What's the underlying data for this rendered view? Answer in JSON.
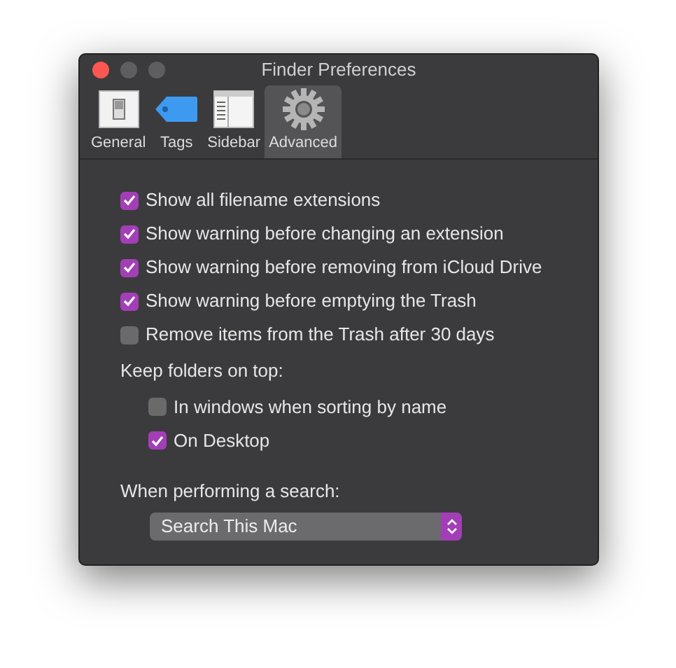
{
  "window": {
    "title": "Finder Preferences"
  },
  "tabs": [
    {
      "label": "General",
      "kind": "general",
      "selected": false
    },
    {
      "label": "Tags",
      "kind": "tags",
      "selected": false
    },
    {
      "label": "Sidebar",
      "kind": "sidebar",
      "selected": false
    },
    {
      "label": "Advanced",
      "kind": "advanced",
      "selected": true
    }
  ],
  "options": [
    {
      "label": "Show all filename extensions",
      "checked": true
    },
    {
      "label": "Show warning before changing an extension",
      "checked": true
    },
    {
      "label": "Show warning before removing from iCloud Drive",
      "checked": true
    },
    {
      "label": "Show warning before emptying the Trash",
      "checked": true
    },
    {
      "label": "Remove items from the Trash after 30 days",
      "checked": false
    }
  ],
  "keep_folders": {
    "label": "Keep folders on top:",
    "options": [
      {
        "label": "In windows when sorting by name",
        "checked": false
      },
      {
        "label": "On Desktop",
        "checked": true
      }
    ]
  },
  "search": {
    "label": "When performing a search:",
    "value": "Search This Mac"
  }
}
